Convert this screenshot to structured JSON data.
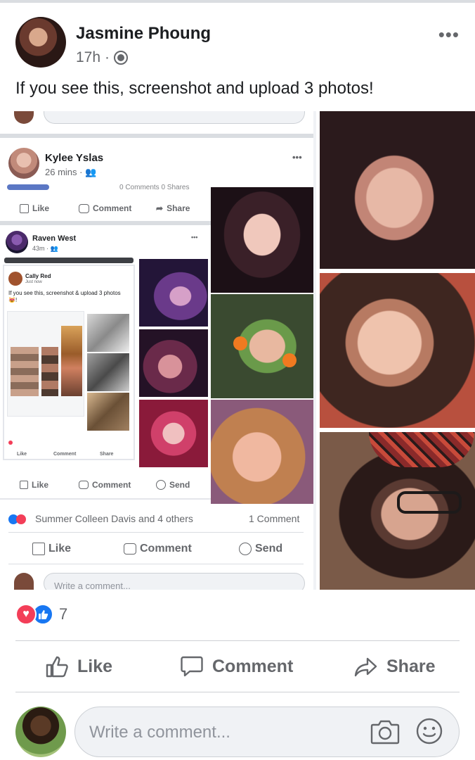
{
  "post": {
    "author": "Jasmine Phoung",
    "time": "17h",
    "separator": "·",
    "caption": "If you see this, screenshot and upload 3 photos!"
  },
  "icons": {
    "globe": "globe-icon",
    "more": "more-icon",
    "like": "thumbs-up-icon",
    "comment": "speech-bubble-icon",
    "share": "share-arrow-icon",
    "send": "messenger-icon",
    "camera": "camera-icon",
    "emoji": "smiley-icon"
  },
  "nested": {
    "post1": {
      "author": "Kylee Yslas",
      "time": "26 mins",
      "partial_counts": "0 Comments  0 Shares",
      "like": "Like",
      "comment": "Comment",
      "share": "Share"
    },
    "post2": {
      "author": "Raven West",
      "time": "43m",
      "like": "Like",
      "comment": "Comment",
      "send": "Send"
    },
    "post3": {
      "author": "Cally Red",
      "time": "Just now",
      "caption": "If you see this, screenshot & upload 3 photos 😻!",
      "like": "Like",
      "comment": "Comment",
      "share": "Share"
    },
    "footer": {
      "reactors": "Summer Colleen Davis and 4 others",
      "comments": "1 Comment",
      "like": "Like",
      "comment": "Comment",
      "send": "Send",
      "placeholder": "Write a comment..."
    }
  },
  "reactions": {
    "count": "7"
  },
  "actions": {
    "like": "Like",
    "comment": "Comment",
    "share": "Share"
  },
  "comment_box": {
    "placeholder": "Write a comment..."
  },
  "colors": {
    "like_blue": "#1877f2",
    "love_red": "#f33e58",
    "text_gray": "#65676b"
  }
}
